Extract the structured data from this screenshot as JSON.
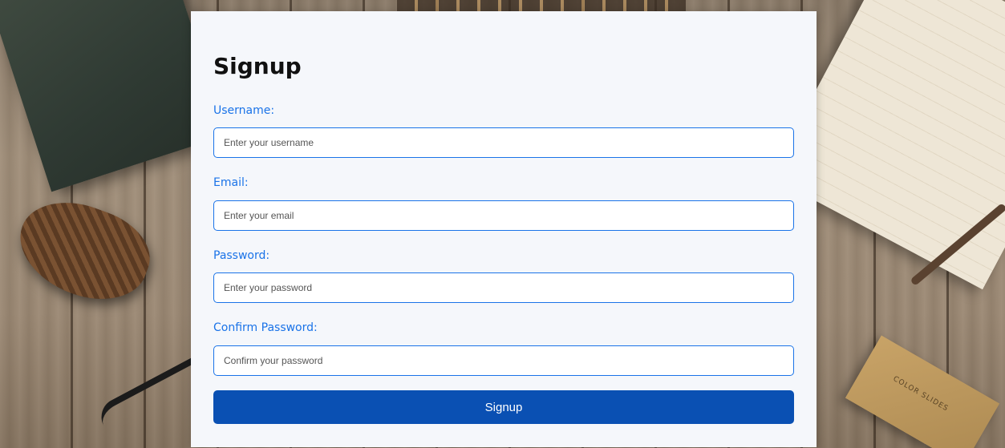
{
  "form": {
    "title": "Signup",
    "fields": [
      {
        "label": "Username:",
        "placeholder": "Enter your username"
      },
      {
        "label": "Email:",
        "placeholder": "Enter your email"
      },
      {
        "label": "Password:",
        "placeholder": "Enter your password"
      },
      {
        "label": "Confirm Password:",
        "placeholder": "Confirm your password"
      }
    ],
    "submit_label": "Signup"
  },
  "background": {
    "box_text": "COLOR SLIDES"
  },
  "colors": {
    "accent": "#1a73e8",
    "button": "#0a50b3",
    "card": "#f5f7fb"
  }
}
